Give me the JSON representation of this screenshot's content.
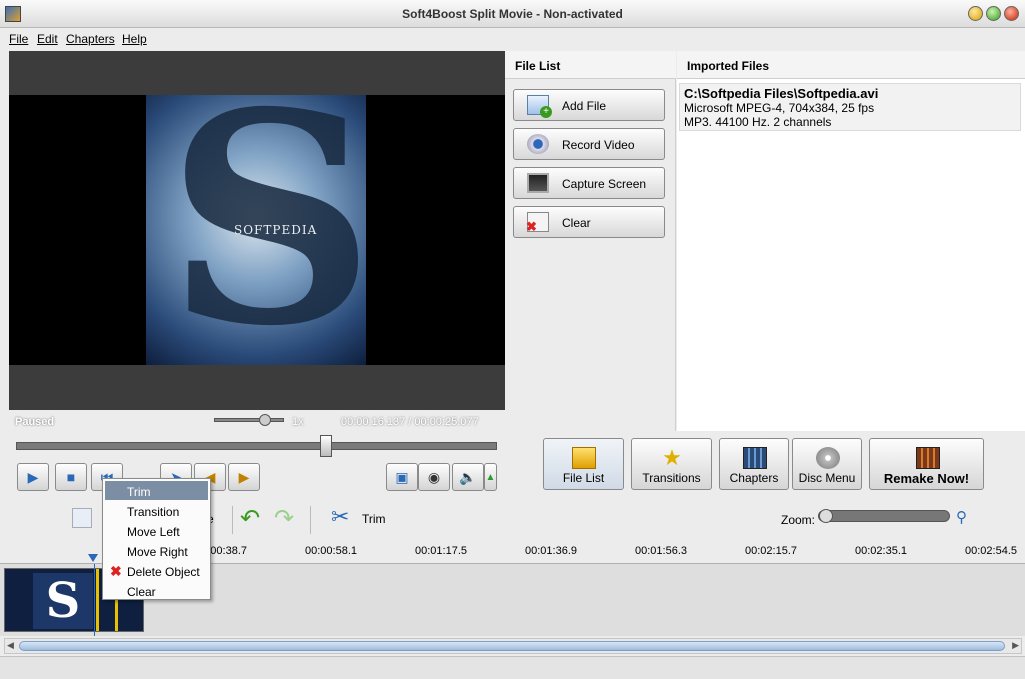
{
  "window": {
    "title": "Soft4Boost Split Movie - Non-activated"
  },
  "menu": [
    "File",
    "Edit",
    "Chapters",
    "Help"
  ],
  "player": {
    "watermark": "SOFTPEDIA",
    "status": "Paused",
    "speed": "1x",
    "time": "00:00:16.137  /  00:00:25.077"
  },
  "file_list": {
    "header": "File List",
    "buttons": [
      "Add File",
      "Record Video",
      "Capture Screen",
      "Clear"
    ]
  },
  "imported": {
    "header": "Imported Files",
    "path": "C:\\Softpedia Files\\Softpedia.avi",
    "line2": "Microsoft MPEG-4, 704x384, 25 fps",
    "line3": "MP3. 44100 Hz. 2 channels"
  },
  "tools": [
    "File List",
    "Transitions",
    "Chapters",
    "Disc Menu",
    "Remake Now!"
  ],
  "edit": {
    "trim_label": "Trim",
    "zoom_label": "Zoom:",
    "partial_label": "e"
  },
  "ruler": [
    "00:00:38.7",
    "00:00:58.1",
    "00:01:17.5",
    "00:01:36.9",
    "00:01:56.3",
    "00:02:15.7",
    "00:02:35.1",
    "00:02:54.5"
  ],
  "context_menu": [
    "Trim",
    "Transition",
    "Move Left",
    "Move Right",
    "Delete Object",
    "Clear"
  ],
  "clip_letter": "S",
  "colors": {
    "accent": "#2a68b8",
    "menu_highlight": "#7c8ea3",
    "delete": "#dd2222"
  }
}
